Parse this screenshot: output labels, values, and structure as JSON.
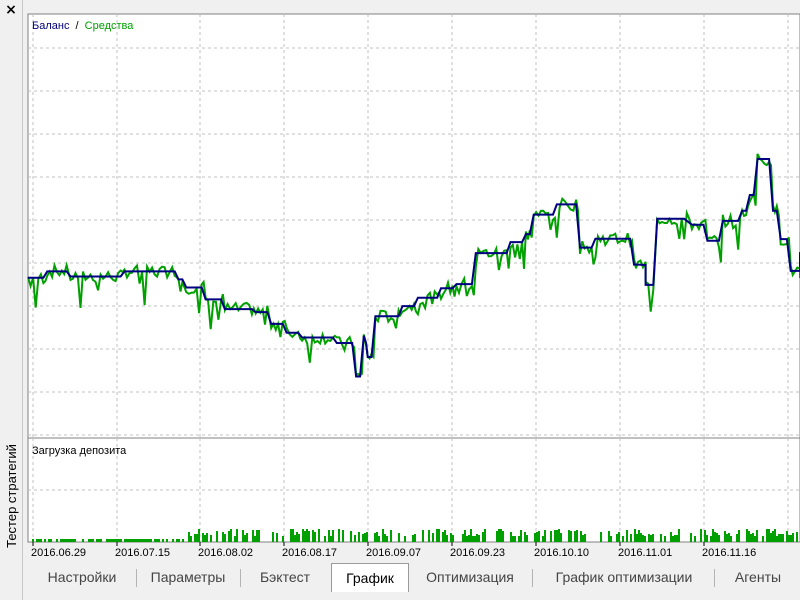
{
  "panel": {
    "close_glyph": "×",
    "title": "Тестер стратегий"
  },
  "legend": {
    "balance": "Баланс",
    "separator": "/",
    "equity": "Средства"
  },
  "lower_chart": {
    "title": "Загрузка депозита"
  },
  "tabs": [
    {
      "label": "Настройки",
      "active": false
    },
    {
      "label": "Параметры",
      "active": false
    },
    {
      "label": "Бэктест",
      "active": false
    },
    {
      "label": "График",
      "active": true
    },
    {
      "label": "Оптимизация",
      "active": false
    },
    {
      "label": "График оптимизации",
      "active": false
    },
    {
      "label": "Агенты",
      "active": false
    }
  ],
  "colors": {
    "balance": "#000080",
    "equity": "#00a000",
    "load": "#00a000",
    "grid": "#c0c0c0"
  },
  "chart_data": {
    "type": "line",
    "x_tick_labels": [
      "2016.06.29",
      "2016.07.15",
      "2016.08.02",
      "2016.08.17",
      "2016.09.07",
      "2016.09.23",
      "2016.10.10",
      "2016.11.01",
      "2016.11.16"
    ],
    "y_range": [
      0,
      100
    ],
    "grid": true,
    "legend_position": "top-left",
    "series": [
      {
        "name": "Баланс",
        "color": "#000080",
        "values": [
          [
            0,
            37.8
          ],
          [
            0.02,
            37.8
          ],
          [
            0.025,
            39.3
          ],
          [
            0.05,
            39.3
          ],
          [
            0.055,
            38.1
          ],
          [
            0.12,
            38.1
          ],
          [
            0.125,
            39.3
          ],
          [
            0.19,
            39.3
          ],
          [
            0.195,
            37.4
          ],
          [
            0.2,
            37.4
          ],
          [
            0.205,
            35.5
          ],
          [
            0.225,
            35.5
          ],
          [
            0.23,
            32.7
          ],
          [
            0.25,
            32.7
          ],
          [
            0.255,
            30.4
          ],
          [
            0.29,
            30.4
          ],
          [
            0.295,
            29.7
          ],
          [
            0.31,
            29.7
          ],
          [
            0.315,
            26.9
          ],
          [
            0.33,
            26.9
          ],
          [
            0.335,
            24.8
          ],
          [
            0.35,
            24.8
          ],
          [
            0.355,
            23.7
          ],
          [
            0.395,
            23.7
          ],
          [
            0.4,
            22.4
          ],
          [
            0.42,
            22.4
          ],
          [
            0.425,
            14.5
          ],
          [
            0.43,
            14.5
          ],
          [
            0.435,
            24.1
          ],
          [
            0.438,
            22.4
          ],
          [
            0.44,
            19.1
          ],
          [
            0.445,
            19.1
          ],
          [
            0.45,
            28.7
          ],
          [
            0.48,
            28.7
          ],
          [
            0.485,
            31.1
          ],
          [
            0.5,
            31.1
          ],
          [
            0.505,
            33.1
          ],
          [
            0.53,
            33.1
          ],
          [
            0.535,
            35.3
          ],
          [
            0.55,
            35.3
          ],
          [
            0.555,
            36.3
          ],
          [
            0.575,
            36.3
          ],
          [
            0.58,
            43.6
          ],
          [
            0.62,
            43.6
          ],
          [
            0.625,
            46.2
          ],
          [
            0.64,
            46.2
          ],
          [
            0.645,
            48.1
          ],
          [
            0.65,
            48.1
          ],
          [
            0.655,
            52.7
          ],
          [
            0.68,
            52.7
          ],
          [
            0.685,
            55.1
          ],
          [
            0.71,
            55.1
          ],
          [
            0.715,
            44.9
          ],
          [
            0.73,
            44.9
          ],
          [
            0.735,
            47
          ],
          [
            0.78,
            47
          ],
          [
            0.785,
            40.9
          ],
          [
            0.79,
            40.9
          ],
          [
            0.8,
            40.8
          ],
          [
            0.8,
            36.1
          ],
          [
            0.81,
            36.1
          ],
          [
            0.815,
            51.7
          ],
          [
            0.85,
            51.7
          ],
          [
            0.86,
            50.3
          ],
          [
            0.875,
            50.3
          ],
          [
            0.88,
            46.5
          ],
          [
            0.895,
            46.5
          ],
          [
            0.9,
            51.2
          ],
          [
            0.92,
            51.2
          ],
          [
            0.925,
            53.6
          ],
          [
            0.93,
            53.6
          ],
          [
            0.935,
            57.3
          ],
          [
            0.94,
            57.3
          ],
          [
            0.945,
            65.8
          ],
          [
            0.96,
            65.8
          ],
          [
            0.965,
            53.6
          ],
          [
            0.97,
            53.6
          ],
          [
            0.975,
            46.9
          ],
          [
            0.983,
            46.9
          ],
          [
            0.988,
            39.4
          ],
          [
            0.993,
            39.4
          ],
          [
            1.0,
            39.4
          ],
          [
            1.0,
            43.6
          ],
          [
            1.02,
            43.6
          ],
          [
            1.02,
            52.0
          ],
          [
            1.04,
            52.0
          ]
        ]
      },
      {
        "name": "Средства",
        "color": "#00a000",
        "values": []
      }
    ]
  }
}
